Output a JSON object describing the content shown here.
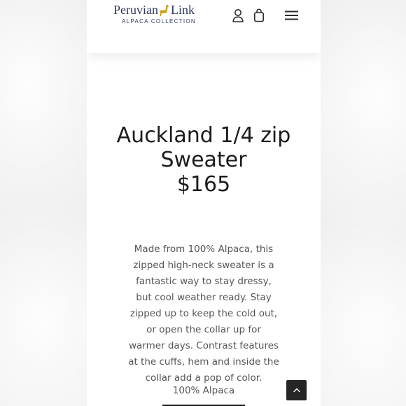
{
  "header": {
    "logo": {
      "name_left": "Peruvian",
      "name_right": "Link",
      "tagline": "ALPACA COLLECTION",
      "emblem_icon": "alpaca-icon",
      "emblem_color": "#c9a227"
    },
    "icons": {
      "account": "user-icon",
      "cart": "shopping-bag-icon",
      "menu": "hamburger-menu-icon"
    }
  },
  "product": {
    "title": "Auckland 1/4 zip Sweater",
    "price": "$165",
    "description": "Made from 100% Alpaca, this zipped high-neck sweater is a fantastic way to stay dressy, but cool weather ready. Stay zipped up to keep the cold out, or open the collar up for warmer days. Contrast features at the cuffs, hem and inside the collar add a pop of color.",
    "material": "100% Alpaca"
  },
  "scroll_top": {
    "icon": "chevron-up-icon"
  },
  "colors": {
    "brand_navy": "#2d3a5e",
    "brand_gold": "#c9a227",
    "text_dark": "#1c1c1c",
    "text_body": "#555555",
    "button_dark": "#262626"
  }
}
